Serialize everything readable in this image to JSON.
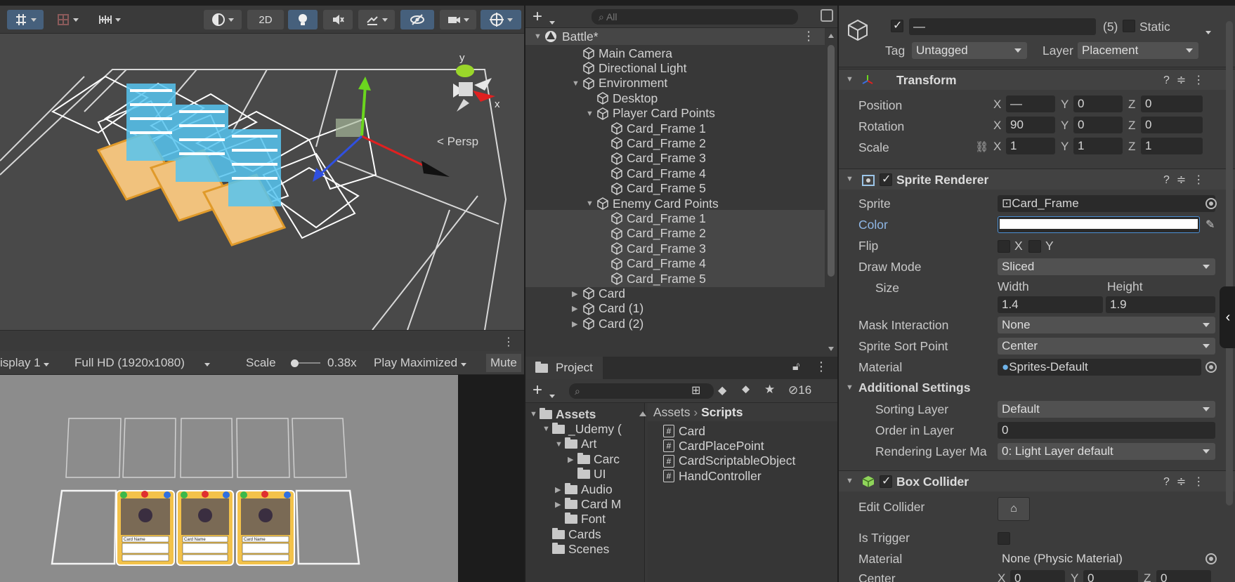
{
  "scene_view": {
    "toolbar": {
      "mode_2d": "2D"
    },
    "gizmo": {
      "persp_label": "Persp",
      "axes": [
        "y",
        "x"
      ]
    }
  },
  "game_view": {
    "display": "isplay 1",
    "resolution": "Full HD (1920x1080)",
    "scale_label": "Scale",
    "scale_value": "0.38x",
    "play_mode": "Play Maximized",
    "mute": "Mute",
    "card_text": {
      "name": "Card Name",
      "slots": 5,
      "cards_in_hand": 3
    }
  },
  "hierarchy": {
    "search_placeholder": "All",
    "scene_name": "Battle*",
    "items": [
      {
        "label": "Main Camera",
        "depth": 1,
        "fold": ""
      },
      {
        "label": "Directional Light",
        "depth": 1,
        "fold": ""
      },
      {
        "label": "Environment",
        "depth": 1,
        "fold": "down"
      },
      {
        "label": "Desktop",
        "depth": 2,
        "fold": ""
      },
      {
        "label": "Player Card Points",
        "depth": 2,
        "fold": "down"
      },
      {
        "label": "Card_Frame 1",
        "depth": 3,
        "fold": ""
      },
      {
        "label": "Card_Frame 2",
        "depth": 3,
        "fold": ""
      },
      {
        "label": "Card_Frame 3",
        "depth": 3,
        "fold": ""
      },
      {
        "label": "Card_Frame 4",
        "depth": 3,
        "fold": ""
      },
      {
        "label": "Card_Frame 5",
        "depth": 3,
        "fold": ""
      },
      {
        "label": "Enemy Card Points",
        "depth": 2,
        "fold": "down"
      },
      {
        "label": "Card_Frame 1",
        "depth": 3,
        "fold": "",
        "selected": true
      },
      {
        "label": "Card_Frame 2",
        "depth": 3,
        "fold": "",
        "selected": true
      },
      {
        "label": "Card_Frame 3",
        "depth": 3,
        "fold": "",
        "selected": true
      },
      {
        "label": "Card_Frame 4",
        "depth": 3,
        "fold": "",
        "selected": true
      },
      {
        "label": "Card_Frame 5",
        "depth": 3,
        "fold": "",
        "selected": true
      },
      {
        "label": "Card",
        "depth": 1,
        "fold": "right"
      },
      {
        "label": "Card (1)",
        "depth": 1,
        "fold": "right"
      },
      {
        "label": "Card (2)",
        "depth": 1,
        "fold": "right"
      }
    ]
  },
  "project": {
    "tab_label": "Project",
    "hidden_count": "16",
    "breadcrumb": [
      "Assets",
      "Scripts"
    ],
    "tree": [
      {
        "label": "Assets",
        "depth": 0,
        "fold": "down",
        "bold": true
      },
      {
        "label": "_Udemy (",
        "depth": 1,
        "fold": "down"
      },
      {
        "label": "Art",
        "depth": 2,
        "fold": "down"
      },
      {
        "label": "Carc",
        "depth": 3,
        "fold": "right"
      },
      {
        "label": "UI",
        "depth": 3,
        "fold": ""
      },
      {
        "label": "Audio",
        "depth": 2,
        "fold": "right"
      },
      {
        "label": "Card M",
        "depth": 2,
        "fold": "right"
      },
      {
        "label": "Font",
        "depth": 2,
        "fold": ""
      },
      {
        "label": "Cards",
        "depth": 1,
        "fold": ""
      },
      {
        "label": "Scenes",
        "depth": 1,
        "fold": ""
      }
    ],
    "files": [
      "Card",
      "CardPlacePoint",
      "CardScriptableObject",
      "HandController"
    ]
  },
  "inspector": {
    "tab_label": "Inspector",
    "object_name": "—",
    "selection_count": "(5)",
    "static_label": "Static",
    "tag_label": "Tag",
    "tag_value": "Untagged",
    "layer_label": "Layer",
    "layer_value": "Placement",
    "transform": {
      "title": "Transform",
      "position_label": "Position",
      "rotation_label": "Rotation",
      "scale_label": "Scale",
      "position": {
        "x": "—",
        "y": "0",
        "z": "0"
      },
      "rotation": {
        "x": "90",
        "y": "0",
        "z": "0"
      },
      "scale": {
        "x": "1",
        "y": "1",
        "z": "1"
      }
    },
    "sprite_renderer": {
      "title": "Sprite Renderer",
      "sprite_label": "Sprite",
      "sprite_value": "Card_Frame",
      "color_label": "Color",
      "color_value": "#ffffff",
      "flip_label": "Flip",
      "flip_x": "X",
      "flip_y": "Y",
      "draw_mode_label": "Draw Mode",
      "draw_mode_value": "Sliced",
      "size_label": "Size",
      "width_label": "Width",
      "height_label": "Height",
      "width_value": "1.4",
      "height_value": "1.9",
      "mask_label": "Mask Interaction",
      "mask_value": "None",
      "sort_point_label": "Sprite Sort Point",
      "sort_point_value": "Center",
      "material_label": "Material",
      "material_value": "Sprites-Default",
      "additional_label": "Additional Settings",
      "sorting_layer_label": "Sorting Layer",
      "sorting_layer_value": "Default",
      "order_label": "Order in Layer",
      "order_value": "0",
      "rendering_layer_label": "Rendering Layer Ma",
      "rendering_layer_value": "0: Light Layer default"
    },
    "box_collider": {
      "title": "Box Collider",
      "edit_label": "Edit Collider",
      "trigger_label": "Is Trigger",
      "material_label": "Material",
      "material_value": "None (Physic Material)",
      "center_label": "Center",
      "center": {
        "x": "0",
        "y": "0",
        "z": "0"
      }
    }
  }
}
